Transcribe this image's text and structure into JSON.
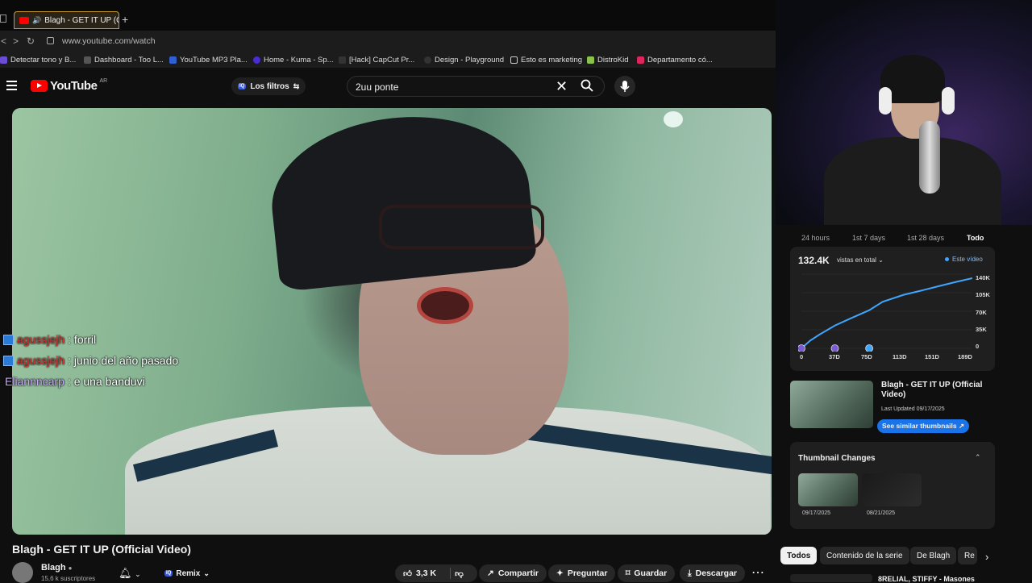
{
  "browser": {
    "tab_title": "Blagh - GET IT UP (Offi",
    "new_tab": "+",
    "url": "www.youtube.com/watch",
    "bookmarks": [
      "Detectar tono y B...",
      "Dashboard - Too L...",
      "YouTube MP3 Pla...",
      "Home - Kuma - Sp...",
      "[Hack] CapCut Pr...",
      "Design - Playground",
      "Esto es marketing",
      "DistroKid",
      "Departamento có..."
    ]
  },
  "header": {
    "logo_text": "YouTube",
    "country_code": "AR",
    "filters_label": "Los filtros",
    "iq_badge": "IQ",
    "search_query": "2uu ponte"
  },
  "chat": [
    {
      "user": "agussjejh",
      "message": ": forril",
      "color": "#dd3333"
    },
    {
      "user": "agussjejh",
      "message": ": junio del año pasado",
      "color": "#dd3333"
    },
    {
      "user": "Eliannncarp",
      "message": ": e una banduvi",
      "color": "#c9a7ff"
    }
  ],
  "video": {
    "title": "Blagh - GET IT UP (Official Video)",
    "channel": "Blagh",
    "subscribers": "15,6 k suscriptores",
    "remix_label": "Remix",
    "likes": "3,3 K",
    "share": "Compartir",
    "ask": "Preguntar",
    "save": "Guardar",
    "download": "Descargar"
  },
  "analytics": {
    "ranges": [
      "24 hours",
      "1st 7 days",
      "1st 28 days",
      "Todo"
    ],
    "active_range": "Todo",
    "total_views": "132.4K",
    "views_label": "vistas en total",
    "legend": "Este vídeo",
    "y_ticks": [
      "140K",
      "105K",
      "70K",
      "35K",
      "0"
    ],
    "x_ticks": [
      "0",
      "37D",
      "75D",
      "113D",
      "151D",
      "189D"
    ]
  },
  "chart_data": {
    "type": "line",
    "title": "",
    "xlabel": "",
    "ylabel": "",
    "x": [
      0,
      10,
      20,
      37,
      55,
      75,
      90,
      113,
      135,
      151,
      170,
      189
    ],
    "series": [
      {
        "name": "Este vídeo",
        "values": [
          0,
          15000,
          26000,
          43000,
          57000,
          72000,
          88000,
          101000,
          110000,
          117000,
          125000,
          132400
        ]
      }
    ],
    "xlim": [
      0,
      189
    ],
    "ylim": [
      0,
      140000
    ],
    "grid": true,
    "accent": "#3ea6ff"
  },
  "thumbnail_card": {
    "video_title": "Blagh - GET IT UP (Official Video)",
    "last_updated": "Last Updated 09/17/2025",
    "similar_button": "See similar thumbnails ↗",
    "changes_title": "Thumbnail Changes",
    "change_dates": [
      "09/17/2025",
      "08/21/2025"
    ]
  },
  "chips": [
    "Todos",
    "Contenido de la serie",
    "De Blagh",
    "Re"
  ],
  "active_chip": "Todos",
  "next_item": "8RELIAL, STIFFY - Masones"
}
